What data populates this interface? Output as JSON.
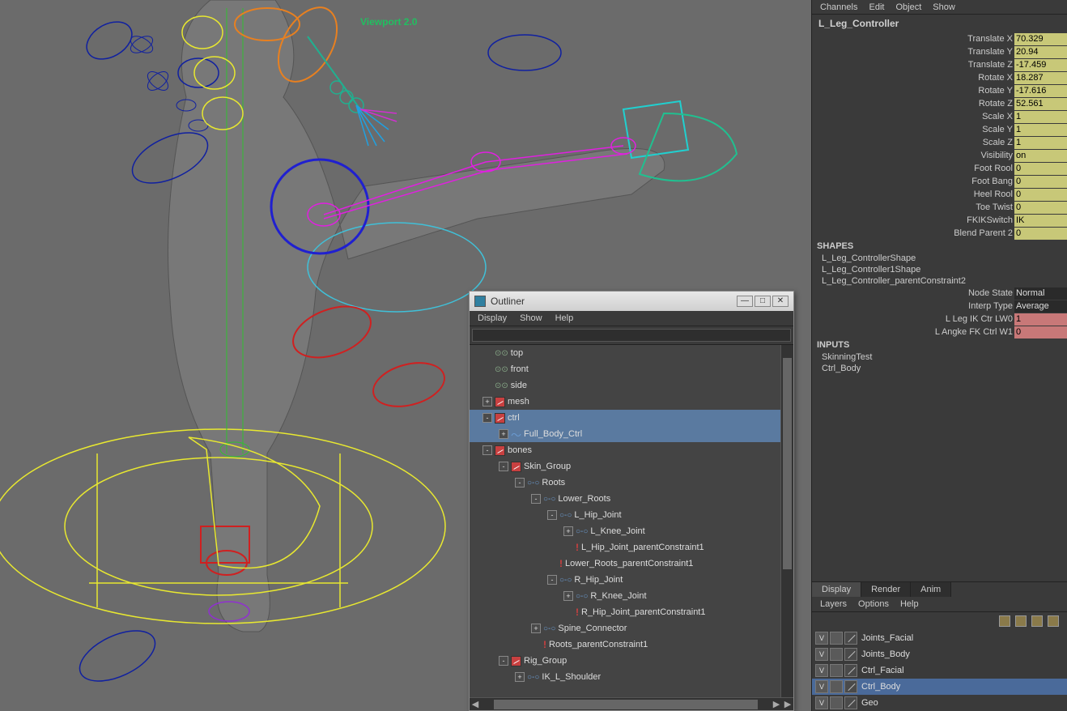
{
  "viewport": {
    "label": "Viewport 2.0"
  },
  "menus": {
    "channel": [
      "Channels",
      "Edit",
      "Object",
      "Show"
    ],
    "outliner": [
      "Display",
      "Show",
      "Help"
    ],
    "layers": [
      "Layers",
      "Options",
      "Help"
    ]
  },
  "nodeName": "L_Leg_Controller",
  "attrs": [
    {
      "label": "Translate X",
      "value": "70.329",
      "class": "yellow"
    },
    {
      "label": "Translate Y",
      "value": "20.94",
      "class": "yellow"
    },
    {
      "label": "Translate Z",
      "value": "-17.459",
      "class": "yellow"
    },
    {
      "label": "Rotate X",
      "value": "18.287",
      "class": "yellow"
    },
    {
      "label": "Rotate Y",
      "value": "-17.616",
      "class": "yellow"
    },
    {
      "label": "Rotate Z",
      "value": "52.561",
      "class": "yellow"
    },
    {
      "label": "Scale X",
      "value": "1",
      "class": "yellow"
    },
    {
      "label": "Scale Y",
      "value": "1",
      "class": "yellow"
    },
    {
      "label": "Scale Z",
      "value": "1",
      "class": "yellow"
    },
    {
      "label": "Visibility",
      "value": "on",
      "class": "yellow"
    },
    {
      "label": "Foot Rool",
      "value": "0",
      "class": "yellow"
    },
    {
      "label": "Foot Bang",
      "value": "0",
      "class": "yellow"
    },
    {
      "label": "Heel Rool",
      "value": "0",
      "class": "yellow"
    },
    {
      "label": "Toe Twist",
      "value": "0",
      "class": "yellow"
    },
    {
      "label": "FKIKSwitch",
      "value": "IK",
      "class": "yellow"
    },
    {
      "label": "Blend Parent 2",
      "value": "0",
      "class": "yellow"
    }
  ],
  "shapesHeader": "SHAPES",
  "shapes": [
    "L_Leg_ControllerShape",
    "L_Leg_Controller1Shape",
    "L_Leg_Controller_parentConstraint2"
  ],
  "constraintAttrs": [
    {
      "label": "Node State",
      "value": "Normal",
      "class": ""
    },
    {
      "label": "Interp Type",
      "value": "Average",
      "class": ""
    },
    {
      "label": "L Leg IK Ctr LW0",
      "value": "1",
      "class": "red"
    },
    {
      "label": "L Angke FK Ctrl W1",
      "value": "0",
      "class": "red"
    }
  ],
  "inputsHeader": "INPUTS",
  "inputs": [
    "SkinningTest",
    "Ctrl_Body"
  ],
  "tabs": {
    "display": "Display",
    "render": "Render",
    "anim": "Anim"
  },
  "layers": [
    {
      "v": "V",
      "name": "Joints_Facial",
      "selected": false
    },
    {
      "v": "V",
      "name": "Joints_Body",
      "selected": false
    },
    {
      "v": "V",
      "name": "Ctrl_Facial",
      "selected": false
    },
    {
      "v": "V",
      "name": "Ctrl_Body",
      "selected": true
    },
    {
      "v": "V",
      "name": "Geo",
      "selected": false
    }
  ],
  "outliner": {
    "title": "Outliner",
    "search": "",
    "tree": [
      {
        "indent": 0,
        "toggle": "",
        "icon": "cam",
        "label": "top"
      },
      {
        "indent": 0,
        "toggle": "",
        "icon": "cam",
        "label": "front"
      },
      {
        "indent": 0,
        "toggle": "",
        "icon": "cam",
        "label": "side"
      },
      {
        "indent": 0,
        "toggle": "+",
        "icon": "mesh",
        "label": "mesh"
      },
      {
        "indent": 0,
        "toggle": "-",
        "icon": "mesh",
        "label": "ctrl",
        "selected": true
      },
      {
        "indent": 1,
        "toggle": "+",
        "icon": "curve",
        "label": "Full_Body_Ctrl",
        "selected": true
      },
      {
        "indent": 0,
        "toggle": "-",
        "icon": "mesh",
        "label": "bones"
      },
      {
        "indent": 1,
        "toggle": "-",
        "icon": "mesh",
        "label": "Skin_Group"
      },
      {
        "indent": 2,
        "toggle": "-",
        "icon": "joint",
        "label": "Roots"
      },
      {
        "indent": 3,
        "toggle": "-",
        "icon": "joint",
        "label": "Lower_Roots"
      },
      {
        "indent": 4,
        "toggle": "-",
        "icon": "joint",
        "label": "L_Hip_Joint"
      },
      {
        "indent": 5,
        "toggle": "+",
        "icon": "joint",
        "label": "L_Knee_Joint"
      },
      {
        "indent": 5,
        "toggle": "",
        "icon": "constraint",
        "label": "L_Hip_Joint_parentConstraint1"
      },
      {
        "indent": 4,
        "toggle": "",
        "icon": "constraint",
        "label": "Lower_Roots_parentConstraint1"
      },
      {
        "indent": 4,
        "toggle": "-",
        "icon": "joint",
        "label": "R_Hip_Joint"
      },
      {
        "indent": 5,
        "toggle": "+",
        "icon": "joint",
        "label": "R_Knee_Joint"
      },
      {
        "indent": 5,
        "toggle": "",
        "icon": "constraint",
        "label": "R_Hip_Joint_parentConstraint1"
      },
      {
        "indent": 3,
        "toggle": "+",
        "icon": "joint",
        "label": "Spine_Connector"
      },
      {
        "indent": 3,
        "toggle": "",
        "icon": "constraint",
        "label": "Roots_parentConstraint1"
      },
      {
        "indent": 1,
        "toggle": "-",
        "icon": "mesh",
        "label": "Rig_Group"
      },
      {
        "indent": 2,
        "toggle": "+",
        "icon": "joint",
        "label": "IK_L_Shoulder"
      }
    ]
  }
}
